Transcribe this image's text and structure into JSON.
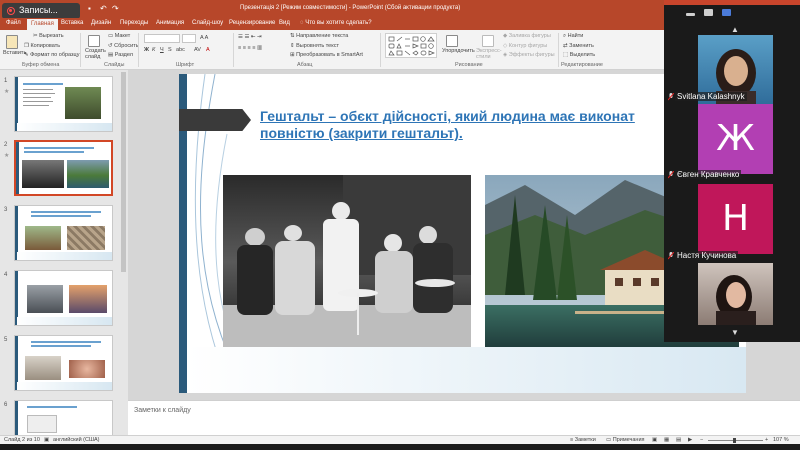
{
  "titlebar": {
    "recording_label": "Записы...",
    "window_title": "Презентація 2 [Режим совместимости] - PowerPoint (Сбой активации продукта)"
  },
  "ribbon_tabs": [
    "Файл",
    "Главная",
    "Вставка",
    "Дизайн",
    "Переходы",
    "Анимация",
    "Слайд-шоу",
    "Рецензирование",
    "Вид"
  ],
  "active_tab": "Главная",
  "tell_me": "Что вы хотите сделать?",
  "clipboard": {
    "paste": "Вставить",
    "cut": "Вырезать",
    "copy": "Копировать",
    "format_painter": "Формат по образцу",
    "group": "Буфер обмена"
  },
  "slides_group": {
    "new_slide": "Создать слайд",
    "layout": "Макет",
    "reset": "Сбросить",
    "section": "Раздел",
    "group": "Слайды"
  },
  "font_group": {
    "group": "Шрифт"
  },
  "paragraph": {
    "text_direction": "Направление текста",
    "align_text": "Выровнять текст",
    "smartart": "Преобразовать в SmartArt",
    "group": "Абзац"
  },
  "drawing": {
    "arrange": "Упорядочить",
    "quick_styles": "Экспресс-стили",
    "fill": "Заливка фигуры",
    "outline": "Контур фигуры",
    "effects": "Эффекты фигуры",
    "group": "Рисование"
  },
  "editing": {
    "find": "Найти",
    "replace": "Заменить",
    "select": "Выделить",
    "group": "Редактирование"
  },
  "thumbnails": [
    "1",
    "2",
    "3",
    "4",
    "5",
    "6"
  ],
  "slide": {
    "heading": "Гештальт – обєкт дійсності, який людина має виконат повністю (закрити гештальт)."
  },
  "notes_placeholder": "Заметки к слайду",
  "status": {
    "slide_count": "Слайд 2 из 10",
    "language": "английский (США)",
    "notes": "Заметки",
    "comments": "Примечания",
    "zoom": "107 %"
  },
  "participants": [
    {
      "name": "Svitlana Kalashnyk",
      "kind": "video"
    },
    {
      "name": "Євген Кравченко",
      "kind": "letter",
      "letter": "Ж",
      "color": "#b23fb3"
    },
    {
      "name": "Настя Кучинова",
      "kind": "letter",
      "letter": "Н",
      "color": "#c0175a"
    },
    {
      "name": "",
      "kind": "video"
    }
  ],
  "colors": {
    "ppt_accent": "#b7472a",
    "heading_blue": "#2e75b6",
    "selected_thumb": "#d24726"
  }
}
